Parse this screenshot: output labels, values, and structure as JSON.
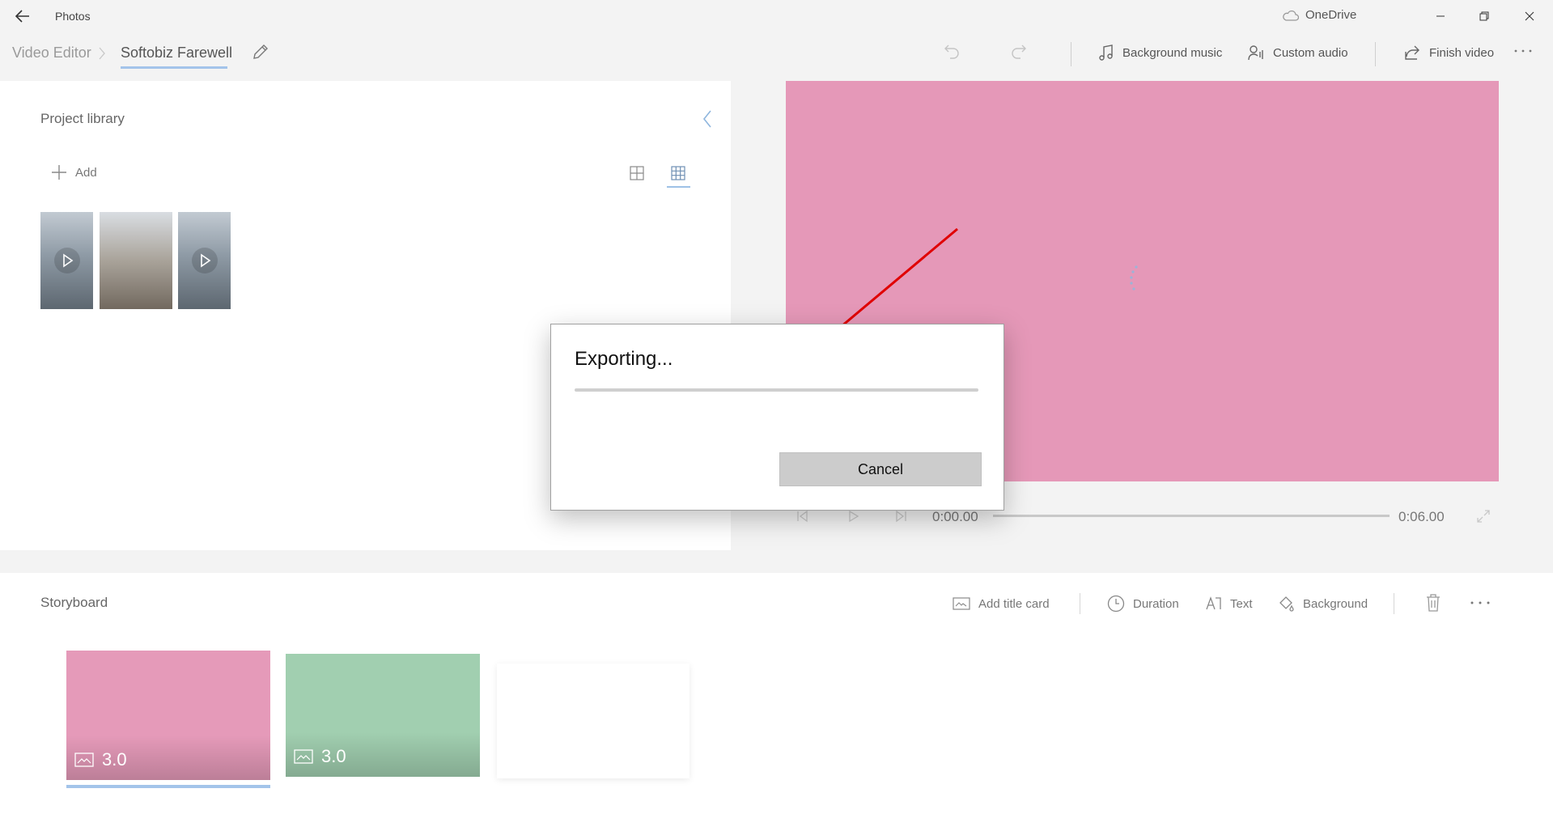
{
  "window": {
    "app_title": "Photos",
    "cloud_label": "OneDrive",
    "icons": [
      "back-arrow-icon",
      "cloud-icon",
      "minimize-icon",
      "restore-icon",
      "close-icon"
    ]
  },
  "toolbar": {
    "breadcrumb_root": "Video Editor",
    "project_name": "Softobiz Farewell",
    "background_music": "Background music",
    "custom_audio": "Custom audio",
    "finish_video": "Finish video"
  },
  "library": {
    "title": "Project library",
    "add_label": "Add",
    "thumbnails": [
      {
        "type": "video",
        "icon": "play-icon"
      },
      {
        "type": "photo"
      },
      {
        "type": "video",
        "icon": "play-icon"
      }
    ]
  },
  "preview": {
    "time_start": "0:00.00",
    "time_end": "0:06.00",
    "color": "#e598b8"
  },
  "storyboard": {
    "title": "Storyboard",
    "add_title_card": "Add title card",
    "duration": "Duration",
    "text": "Text",
    "background": "Background",
    "cards": [
      {
        "duration": "3.0",
        "color": "#e59ab9",
        "selected": true
      },
      {
        "duration": "3.0",
        "color": "#a1cfb0",
        "selected": false
      },
      {
        "duration": "",
        "color": "#ffffff",
        "selected": false
      }
    ]
  },
  "dialog": {
    "title": "Exporting...",
    "progress": 0,
    "cancel_label": "Cancel"
  },
  "annotation": {
    "color": "#e00000",
    "type": "red-arrow"
  },
  "colors": {
    "accent": "#0078d7",
    "selection": "#a3c4ea"
  }
}
